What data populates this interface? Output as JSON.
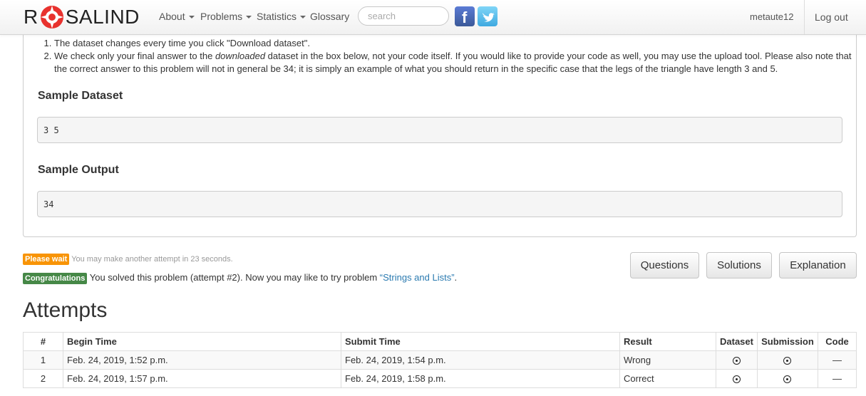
{
  "nav": {
    "logo_letters": {
      "r": "R",
      "rest": "SALIND"
    },
    "menu": [
      "About",
      "Problems",
      "Statistics",
      "Glossary"
    ],
    "search_placeholder": "search",
    "user": "metaute12",
    "logout": "Log out"
  },
  "notes": [
    "The dataset changes every time you click \"Download dataset\".",
    {
      "pre": "We check only your final answer to the ",
      "em": "downloaded",
      "post": " dataset in the box below, not your code itself. If you would like to provide your code as well, you may use the upload tool. Please also note that the correct answer to this problem will not in general be 34; it is simply an example of what you should return in the specific case that the legs of the triangle have length 3 and 5."
    }
  ],
  "sample_dataset": {
    "title": "Sample Dataset",
    "value": "3 5"
  },
  "sample_output": {
    "title": "Sample Output",
    "value": "34"
  },
  "status": {
    "wait_label": "Please wait",
    "wait_text": "You may make another attempt in 23 seconds.",
    "congrats_label": "Congratulations",
    "congrats_text": "You solved this problem (attempt #2). Now you may like to try problem",
    "congrats_link": "“Strings and Lists”",
    "congrats_end": "."
  },
  "buttons": {
    "questions": "Questions",
    "solutions": "Solutions",
    "explanation": "Explanation"
  },
  "attempts": {
    "title": "Attempts",
    "headers": [
      "#",
      "Begin Time",
      "Submit Time",
      "Result",
      "Dataset",
      "Submission",
      "Code"
    ],
    "rows": [
      {
        "num": "1",
        "begin": "Feb. 24, 2019, 1:52 p.m.",
        "submit": "Feb. 24, 2019, 1:54 p.m.",
        "result": "Wrong",
        "code": "—"
      },
      {
        "num": "2",
        "begin": "Feb. 24, 2019, 1:57 p.m.",
        "submit": "Feb. 24, 2019, 1:58 p.m.",
        "result": "Correct",
        "code": "—"
      }
    ]
  },
  "colors": {
    "warn": "#f89406",
    "success": "#468847",
    "link": "#2a7ab0"
  }
}
